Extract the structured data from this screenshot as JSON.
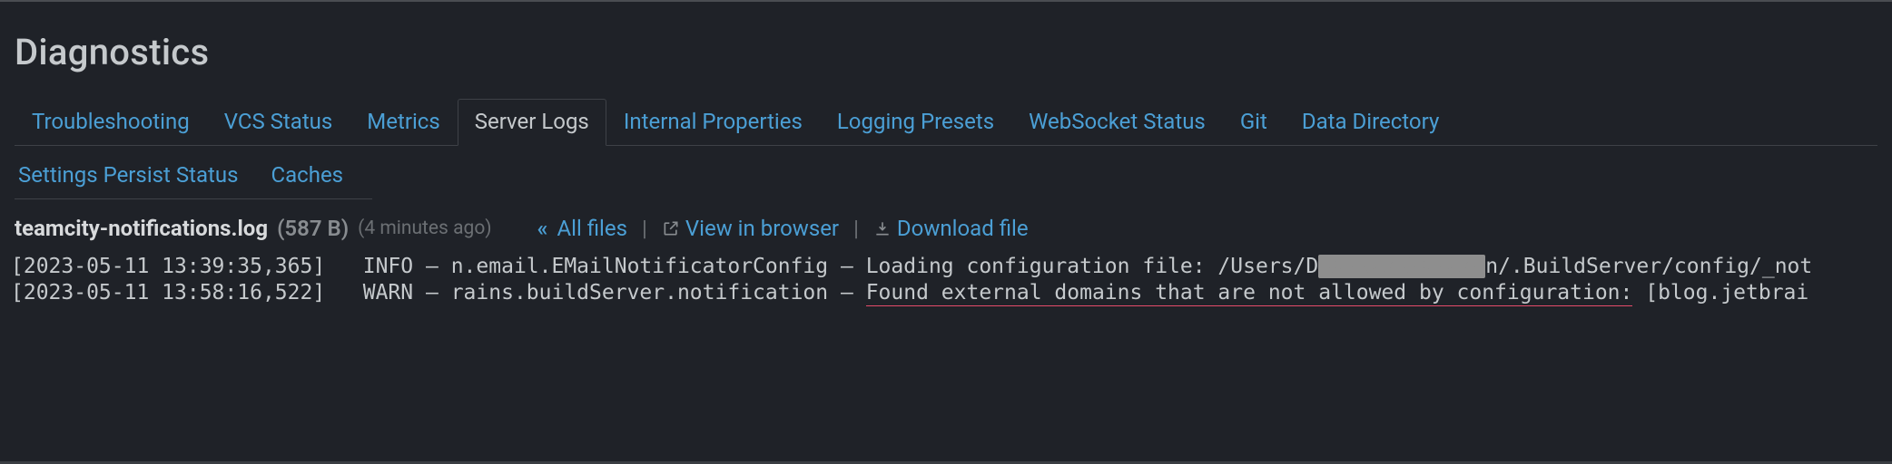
{
  "page": {
    "title": "Diagnostics"
  },
  "tabs": {
    "row1": [
      {
        "label": "Troubleshooting",
        "active": false
      },
      {
        "label": "VCS Status",
        "active": false
      },
      {
        "label": "Metrics",
        "active": false
      },
      {
        "label": "Server Logs",
        "active": true
      },
      {
        "label": "Internal Properties",
        "active": false
      },
      {
        "label": "Logging Presets",
        "active": false
      },
      {
        "label": "WebSocket Status",
        "active": false
      },
      {
        "label": "Git",
        "active": false
      },
      {
        "label": "Data Directory",
        "active": false
      }
    ],
    "row2": [
      {
        "label": "Settings Persist Status"
      },
      {
        "label": "Caches"
      }
    ]
  },
  "file": {
    "name": "teamcity-notifications.log",
    "size": "(587 B)",
    "ago": "(4 minutes ago)",
    "all_files": "All files",
    "view_in_browser": "View in browser",
    "download_file": "Download file"
  },
  "log": {
    "line1": {
      "ts": "[2023-05-11 13:39:35,365]",
      "level": "INFO",
      "dash": "—",
      "logger": "n.email.EMailNotificatorConfig",
      "dash2": "—",
      "msg_pre": "Loading configuration file: /Users/D",
      "redacted": "XXXXXXXXXXXXX",
      "msg_post": "n/.BuildServer/config/_not"
    },
    "line2": {
      "ts": "[2023-05-11 13:58:16,522]",
      "level": "WARN",
      "dash": "—",
      "logger": "rains.buildServer.notification",
      "dash2": "—",
      "msg_underlined": "Found external domains that are not allowed by configuration:",
      "msg_post": " [blog.jetbrai"
    }
  }
}
